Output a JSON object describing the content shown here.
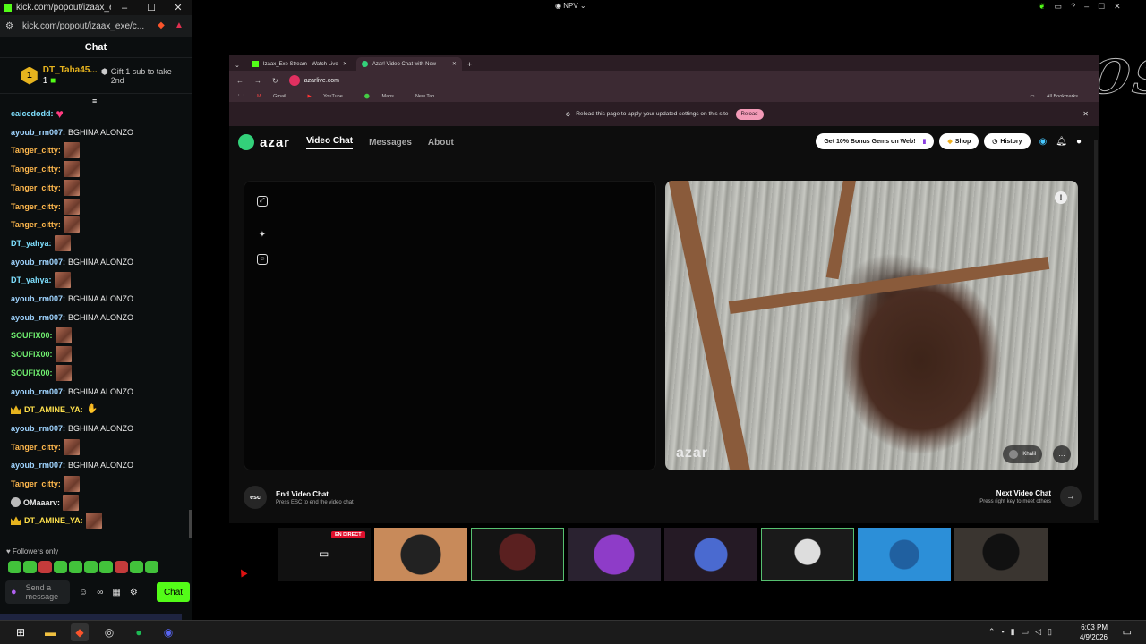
{
  "popout": {
    "title": "kick.com/popout/izaax_exe/...",
    "url": "kick.com/popout/izaax_exe/c...",
    "header": "Chat",
    "pinned": {
      "rank": "1",
      "user": "DT_Taha45...",
      "count": "1",
      "gift_text": "Gift 1 sub to take 2nd"
    },
    "messages": [
      {
        "user": "caicedodd:",
        "text": "",
        "color": "#7fe0ff",
        "emote": "pink",
        "prefix": ""
      },
      {
        "user": "ayoub_rm007:",
        "text": "BGHINA ALONZO",
        "color": "#9fd4ff",
        "emote": "",
        "prefix": ""
      },
      {
        "user": "Tanger_citty:",
        "text": "",
        "color": "#ffb84d",
        "emote": "img",
        "prefix": ""
      },
      {
        "user": "Tanger_citty:",
        "text": "",
        "color": "#ffb84d",
        "emote": "img",
        "prefix": ""
      },
      {
        "user": "Tanger_citty:",
        "text": "",
        "color": "#ffb84d",
        "emote": "img",
        "prefix": ""
      },
      {
        "user": "Tanger_citty:",
        "text": "",
        "color": "#ffb84d",
        "emote": "img",
        "prefix": ""
      },
      {
        "user": "Tanger_citty:",
        "text": "",
        "color": "#ffb84d",
        "emote": "img",
        "prefix": ""
      },
      {
        "user": "DT_yahya:",
        "text": "",
        "color": "#7fe0ff",
        "emote": "img",
        "prefix": ""
      },
      {
        "user": "ayoub_rm007:",
        "text": "BGHINA ALONZO",
        "color": "#9fd4ff",
        "emote": "",
        "prefix": ""
      },
      {
        "user": "DT_yahya:",
        "text": "",
        "color": "#7fe0ff",
        "emote": "img",
        "prefix": ""
      },
      {
        "user": "ayoub_rm007:",
        "text": "BGHINA ALONZO",
        "color": "#9fd4ff",
        "emote": "",
        "prefix": ""
      },
      {
        "user": "ayoub_rm007:",
        "text": "BGHINA ALONZO",
        "color": "#9fd4ff",
        "emote": "",
        "prefix": ""
      },
      {
        "user": "SOUFIX00:",
        "text": "",
        "color": "#70f070",
        "emote": "img",
        "prefix": ""
      },
      {
        "user": "SOUFIX00:",
        "text": "",
        "color": "#70f070",
        "emote": "img",
        "prefix": ""
      },
      {
        "user": "SOUFIX00:",
        "text": "",
        "color": "#70f070",
        "emote": "img",
        "prefix": ""
      },
      {
        "user": "ayoub_rm007:",
        "text": "BGHINA ALONZO",
        "color": "#9fd4ff",
        "emote": "",
        "prefix": ""
      },
      {
        "user": "DT_AMINE_YA:",
        "text": "",
        "color": "#ffe14d",
        "emote": "hand",
        "prefix": "crown"
      },
      {
        "user": "ayoub_rm007:",
        "text": "BGHINA ALONZO",
        "color": "#9fd4ff",
        "emote": "",
        "prefix": ""
      },
      {
        "user": "Tanger_citty:",
        "text": "",
        "color": "#ffb84d",
        "emote": "img",
        "prefix": ""
      },
      {
        "user": "ayoub_rm007:",
        "text": "BGHINA ALONZO",
        "color": "#9fd4ff",
        "emote": "",
        "prefix": ""
      },
      {
        "user": "Tanger_citty:",
        "text": "",
        "color": "#ffb84d",
        "emote": "img",
        "prefix": ""
      },
      {
        "user": "OMaaarv:",
        "text": "",
        "color": "#e8e8e8",
        "emote": "img",
        "prefix": "badge"
      },
      {
        "user": "DT_AMINE_YA:",
        "text": "",
        "color": "#ffe14d",
        "emote": "img",
        "prefix": "crown"
      }
    ],
    "followers_only": "Followers only",
    "send_placeholder": "Send a message",
    "chat_button": "Chat"
  },
  "system": {
    "npv": "NPV",
    "watermark": "NARCOS"
  },
  "browser": {
    "tabs": [
      {
        "label": "Izaax_Exe Stream - Watch Live",
        "color": "#53fc18",
        "active": false
      },
      {
        "label": "Azar! Video Chat with New",
        "color": "#33d17a",
        "active": true
      }
    ],
    "url": "azarlive.com",
    "bookmarks": [
      "Gmail",
      "YouTube",
      "Maps",
      "New Tab"
    ],
    "all_bookmarks": "All Bookmarks",
    "notice": "Reload this page to apply your updated settings on this site",
    "reload_label": "Reload"
  },
  "azar": {
    "logo": "azar",
    "nav": [
      "Video Chat",
      "Messages",
      "About"
    ],
    "bonus_label": "Get 10% Bonus Gems on Web!",
    "shop_label": "Shop",
    "history_label": "History",
    "video_watermark": "azar",
    "partner_name": "Khalil",
    "end_title": "End Video Chat",
    "end_sub": "Press ESC to end the video chat",
    "esc_label": "esc",
    "next_title": "Next Video Chat",
    "next_sub": "Press right key to meet others"
  },
  "strip": {
    "live_label": "EN DIRECT",
    "tiles": [
      "#111111",
      "#c88a5a",
      "#1c1414",
      "#3a2a3a",
      "#2a2030",
      "#1a1a1a",
      "#2c8fd8",
      "#3a3530"
    ]
  },
  "taskbar": {
    "time": "6:03 PM",
    "date": "4/9/2026"
  }
}
